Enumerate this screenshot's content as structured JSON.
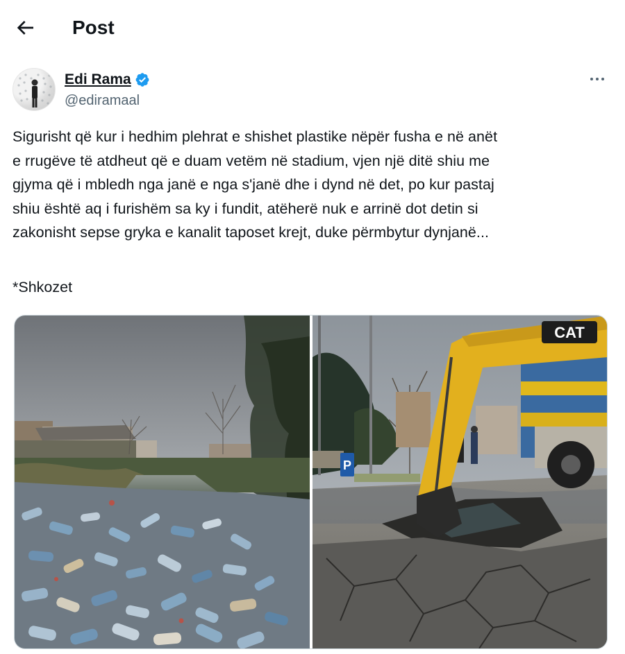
{
  "header": {
    "title": "Post",
    "back_icon": "arrow-left-icon"
  },
  "author": {
    "display_name": "Edi Rama",
    "handle": "@ediramaal",
    "verified": true,
    "verified_color": "#1d9bf0",
    "more_icon": "more-horizontal-icon"
  },
  "tweet": {
    "lines": [
      "Sigurisht që kur i hedhim plehrat e shishet plastike nëpër fusha e në anët",
      "e rrugëve të atdheut që e duam vetëm në stadium, vjen një ditë shiu me",
      "gjyma që i mbledh nga janë e nga s'janë dhe i dynd në det, po kur pastaj",
      "shiu është aq i furishëm sa ky i fundit, atëherë nuk e arrinë dot detin si",
      "zakonisht sepse gryka e kanalit taposet krejt, duke përmbytur dynjanë..."
    ],
    "footnote": "*Shkozet"
  },
  "media": {
    "left_photo": "flooded-canal-with-plastic-bottles",
    "right_photo": "excavator-digging-flooded-street",
    "excavator_brand": "CAT",
    "parking_sign": "P"
  }
}
